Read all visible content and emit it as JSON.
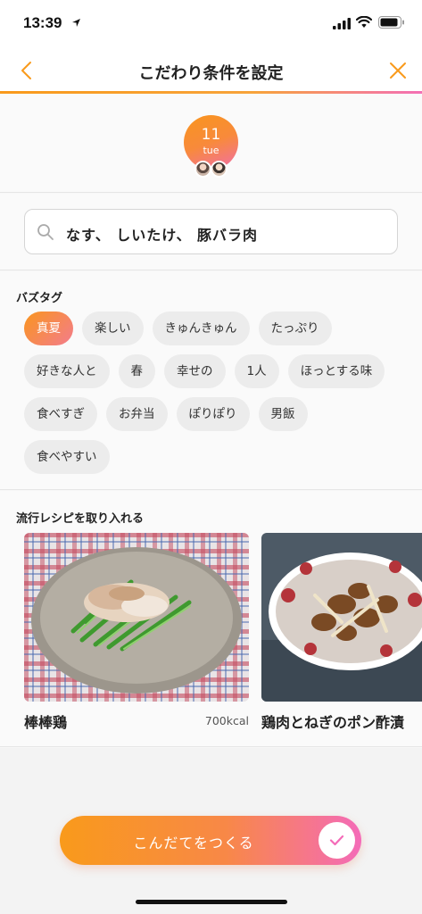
{
  "status_bar": {
    "time": "13:39"
  },
  "nav": {
    "title": "こだわり条件を設定"
  },
  "date": {
    "day": "11",
    "weekday": "tue"
  },
  "search": {
    "value": "なす、 しいたけ、 豚バラ肉"
  },
  "buzz_tags": {
    "heading": "バズタグ",
    "items": [
      {
        "label": "真夏",
        "selected": true
      },
      {
        "label": "楽しい",
        "selected": false
      },
      {
        "label": "きゅんきゅん",
        "selected": false
      },
      {
        "label": "たっぷり",
        "selected": false
      },
      {
        "label": "好きな人と",
        "selected": false
      },
      {
        "label": "春",
        "selected": false
      },
      {
        "label": "幸せの",
        "selected": false
      },
      {
        "label": "1人",
        "selected": false
      },
      {
        "label": "ほっとする味",
        "selected": false
      },
      {
        "label": "食べすぎ",
        "selected": false
      },
      {
        "label": "お弁当",
        "selected": false
      },
      {
        "label": "ぽりぽり",
        "selected": false
      },
      {
        "label": "男飯",
        "selected": false
      },
      {
        "label": "食べやすい",
        "selected": false
      }
    ]
  },
  "trending": {
    "heading": "流行レシピを取り入れる",
    "recipes": [
      {
        "name": "棒棒鶏",
        "kcal": "700kcal"
      },
      {
        "name": "鶏肉とねぎのポン酢漬",
        "kcal": ""
      }
    ]
  },
  "cta": {
    "label": "こんだてをつくる"
  },
  "colors": {
    "accent_orange": "#f99a1b",
    "accent_pink": "#f46bb8"
  }
}
